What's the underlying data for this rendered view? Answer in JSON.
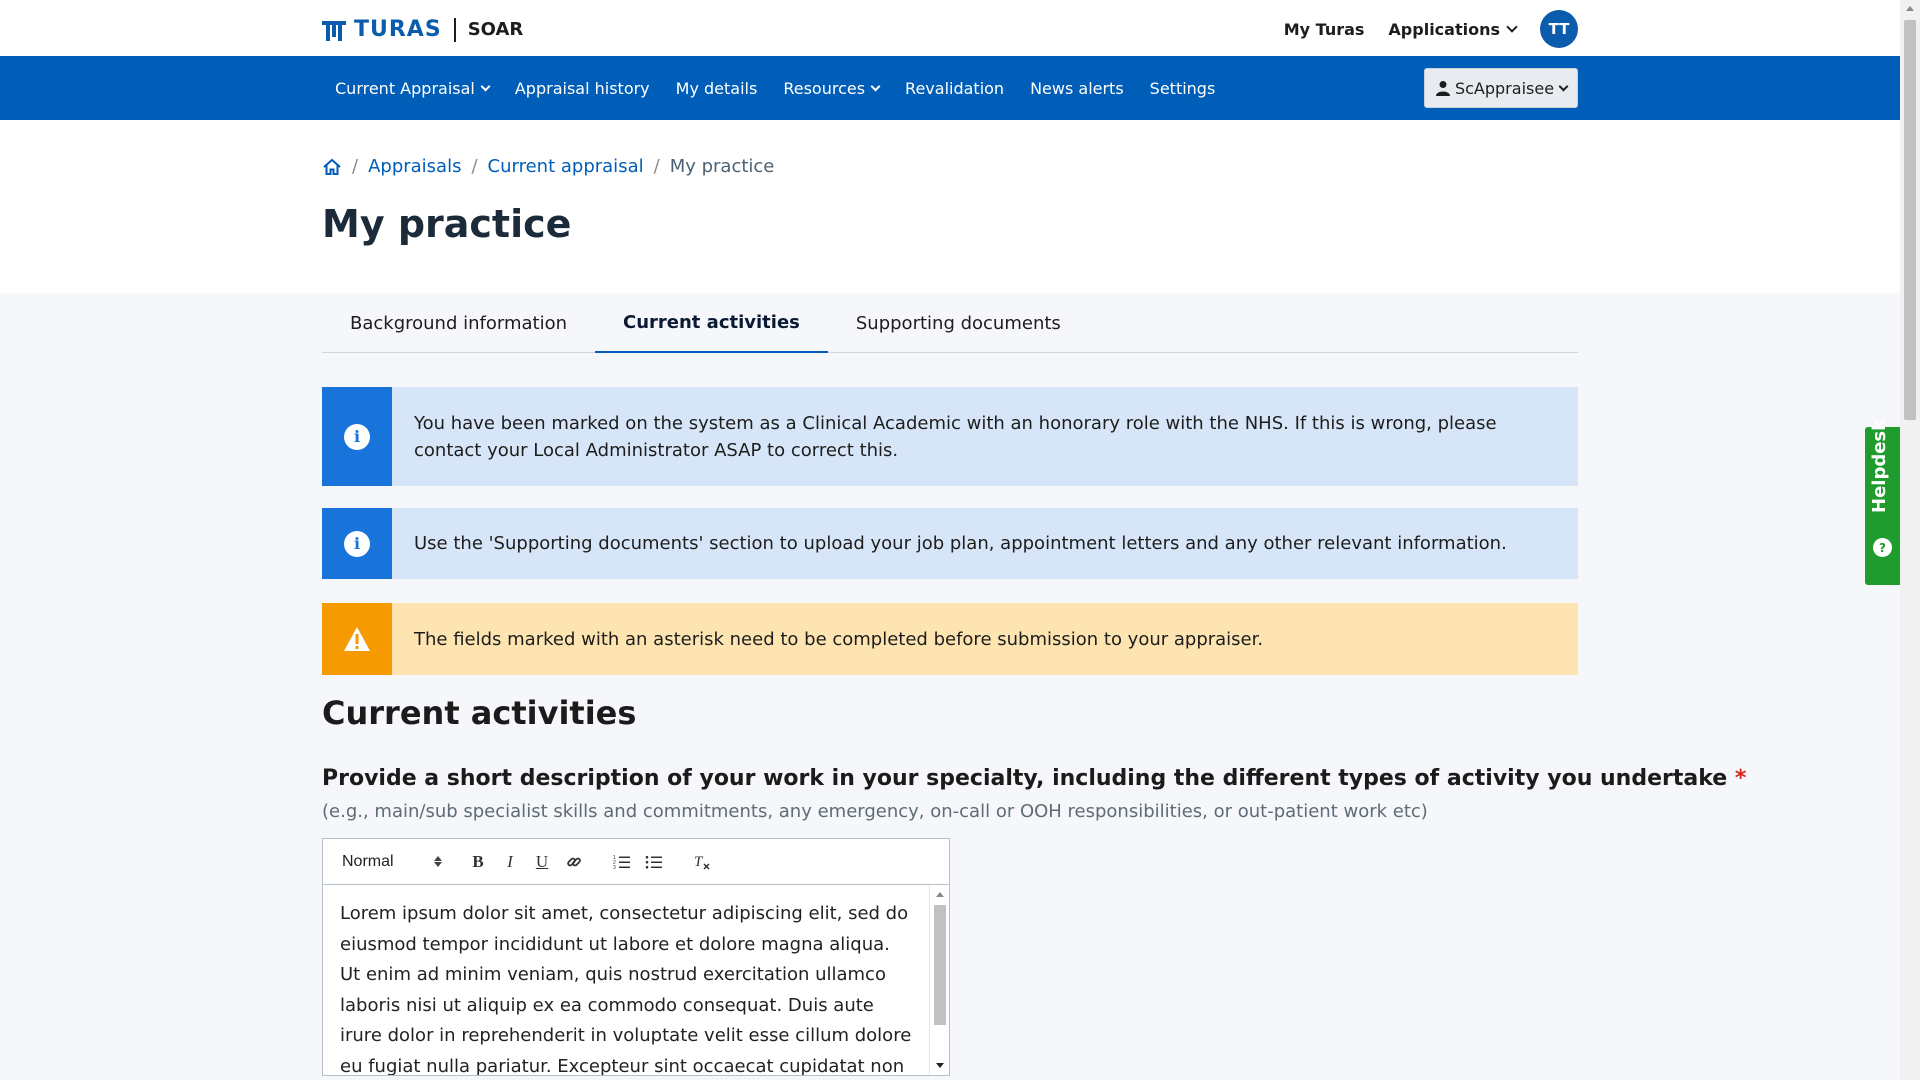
{
  "brand": {
    "name": "TURAS",
    "app": "SOAR",
    "logo_icon": "turas-logo-icon",
    "color": "#0b5cad"
  },
  "topnav": {
    "my_turas": "My Turas",
    "applications": "Applications",
    "avatar_initials": "TT"
  },
  "nav": {
    "items": [
      {
        "label": "Current Appraisal",
        "dropdown": true
      },
      {
        "label": "Appraisal history",
        "dropdown": false
      },
      {
        "label": "My details",
        "dropdown": false
      },
      {
        "label": "Resources",
        "dropdown": true
      },
      {
        "label": "Revalidation",
        "dropdown": false
      },
      {
        "label": "News alerts",
        "dropdown": false
      },
      {
        "label": "Settings",
        "dropdown": false
      }
    ],
    "role": "ScAppraisee",
    "background": "#005eb8"
  },
  "breadcrumb": {
    "home_icon": "home-icon",
    "items": [
      "Appraisals",
      "Current appraisal"
    ],
    "current": "My practice"
  },
  "page": {
    "title": "My practice"
  },
  "tabs": [
    {
      "label": "Background information",
      "active": false
    },
    {
      "label": "Current activities",
      "active": true
    },
    {
      "label": "Supporting documents",
      "active": false
    }
  ],
  "alerts": [
    {
      "type": "info",
      "icon": "info-icon",
      "text": "You have been marked on the system as a Clinical Academic with an honorary role with the NHS. If this is wrong, please contact your Local Administrator ASAP to correct this."
    },
    {
      "type": "info",
      "icon": "info-icon",
      "text": "Use the 'Supporting documents' section to upload your job plan, appointment letters and any other relevant information."
    },
    {
      "type": "warning",
      "icon": "warning-icon",
      "text": "The fields marked with an asterisk need to be completed before submission to your appraiser."
    }
  ],
  "section": {
    "title": "Current activities",
    "field": {
      "label": "Provide a short description of your work in your specialty, including the different types of activity you undertake",
      "required_marker": "*",
      "hint": "(e.g., main/sub specialist skills and commitments, any emergency, on-call or OOH responsibilities, or out-patient work etc)",
      "editor": {
        "format_select": "Normal",
        "value": "Lorem ipsum dolor sit amet, consectetur adipiscing elit, sed do eiusmod tempor incididunt ut labore et dolore magna aliqua. Ut enim ad minim veniam, quis nostrud exercitation ullamco laboris nisi ut aliquip ex ea commodo consequat. Duis aute irure dolor in reprehenderit in voluptate velit esse cillum dolore eu fugiat nulla pariatur. Excepteur sint occaecat cupidatat non proident, sunt in culpa qui officia deserunt mollit anim id est laborum."
      }
    }
  },
  "helpdesk": {
    "label": "Helpdesk",
    "color": "#1e9c2e"
  }
}
